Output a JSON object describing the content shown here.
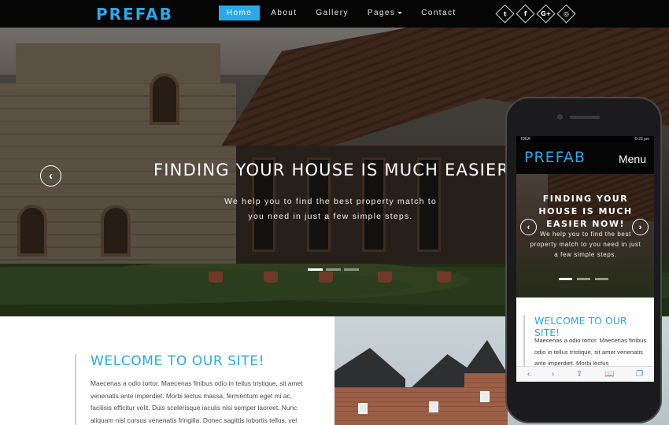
{
  "header": {
    "logo": "PREFAB",
    "nav": [
      {
        "label": "Home",
        "active": true
      },
      {
        "label": "About",
        "active": false
      },
      {
        "label": "Gallery",
        "active": false
      },
      {
        "label": "Pages",
        "active": false,
        "dropdown": true
      },
      {
        "label": "Contact",
        "active": false
      }
    ],
    "socials": [
      {
        "icon": "twitter-icon",
        "glyph": "t"
      },
      {
        "icon": "facebook-icon",
        "glyph": "f"
      },
      {
        "icon": "google-plus-icon",
        "glyph": "G+"
      },
      {
        "icon": "dribbble-icon",
        "glyph": "◎"
      }
    ]
  },
  "hero": {
    "title": "FINDING YOUR HOUSE IS MUCH EASIER NOW!",
    "text": "We help you to find the best property match to you need in just a few simple steps.",
    "prev_icon": "‹",
    "slides": 3,
    "active_slide": 0
  },
  "welcome": {
    "title": "WELCOME TO OUR SITE!",
    "body": "Maecenas a odio tortor. Maecenas finibus odio in tellus tristique, sit amet venenatis ante imperdiet. Morbi lectus massa, fermentum eget mi ac, facilisis efficitur velit. Duis scelerisque iaculis nisi semper laoreet. Nunc aliquam nisl cursus venenatis fringilla. Donec sagittis lobortis tellus, vel"
  },
  "phone": {
    "status_carrier": "IDEA",
    "status_time": "9:20 pm",
    "logo": "PREFAB",
    "menu_label": "Menu",
    "hero_title": "FINDING YOUR HOUSE IS MUCH EASIER NOW!",
    "hero_text": "We help you to find the best property match to you need in just a few simple steps.",
    "prev_icon": "‹",
    "next_icon": "›",
    "welcome_title": "WELCOME TO OUR SITE!",
    "welcome_body": "Maecenas a odio tortor. Maecenas finibus odio in tellus tristique, sit amet venenatis ante imperdiet. Morbi lectus",
    "toolbar": [
      "‹",
      "›",
      "⇪",
      "📖",
      "❐"
    ]
  },
  "colors": {
    "accent": "#29a9e9",
    "topbar": "#050505",
    "body_text": "#4a4a4a"
  }
}
